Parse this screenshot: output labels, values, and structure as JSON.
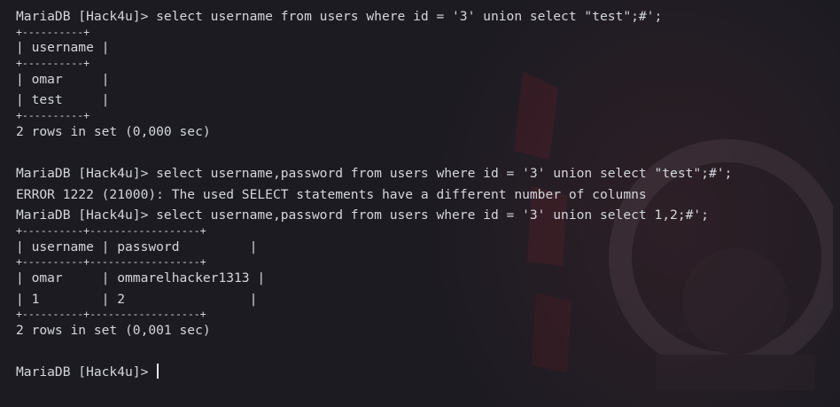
{
  "terminal": {
    "prompt": "MariaDB [Hack4u]> ",
    "lines": [
      {
        "kind": "cmd",
        "text": "MariaDB [Hack4u]> select username from users where id = '3' union select \"test\";#';"
      },
      {
        "kind": "border",
        "text": "+----------+"
      },
      {
        "kind": "text",
        "text": "| username |"
      },
      {
        "kind": "border",
        "text": "+----------+"
      },
      {
        "kind": "text",
        "text": "| omar     |"
      },
      {
        "kind": "text",
        "text": "| test     |"
      },
      {
        "kind": "border",
        "text": "+----------+"
      },
      {
        "kind": "text",
        "text": "2 rows in set (0,000 sec)"
      },
      {
        "kind": "blank",
        "text": ""
      },
      {
        "kind": "cmd",
        "text": "MariaDB [Hack4u]> select username,password from users where id = '3' union select \"test\";#';"
      },
      {
        "kind": "text",
        "text": "ERROR 1222 (21000): The used SELECT statements have a different number of columns"
      },
      {
        "kind": "cmd",
        "text": "MariaDB [Hack4u]> select username,password from users where id = '3' union select 1,2;#';"
      },
      {
        "kind": "border",
        "text": "+----------+------------------+"
      },
      {
        "kind": "text",
        "text": "| username | password         |"
      },
      {
        "kind": "border",
        "text": "+----------+------------------+"
      },
      {
        "kind": "text",
        "text": "| omar     | ommarelhacker1313 |"
      },
      {
        "kind": "text",
        "text": "| 1        | 2                |"
      },
      {
        "kind": "border",
        "text": "+----------+------------------+"
      },
      {
        "kind": "text",
        "text": "2 rows in set (0,001 sec)"
      },
      {
        "kind": "blank",
        "text": ""
      }
    ]
  }
}
